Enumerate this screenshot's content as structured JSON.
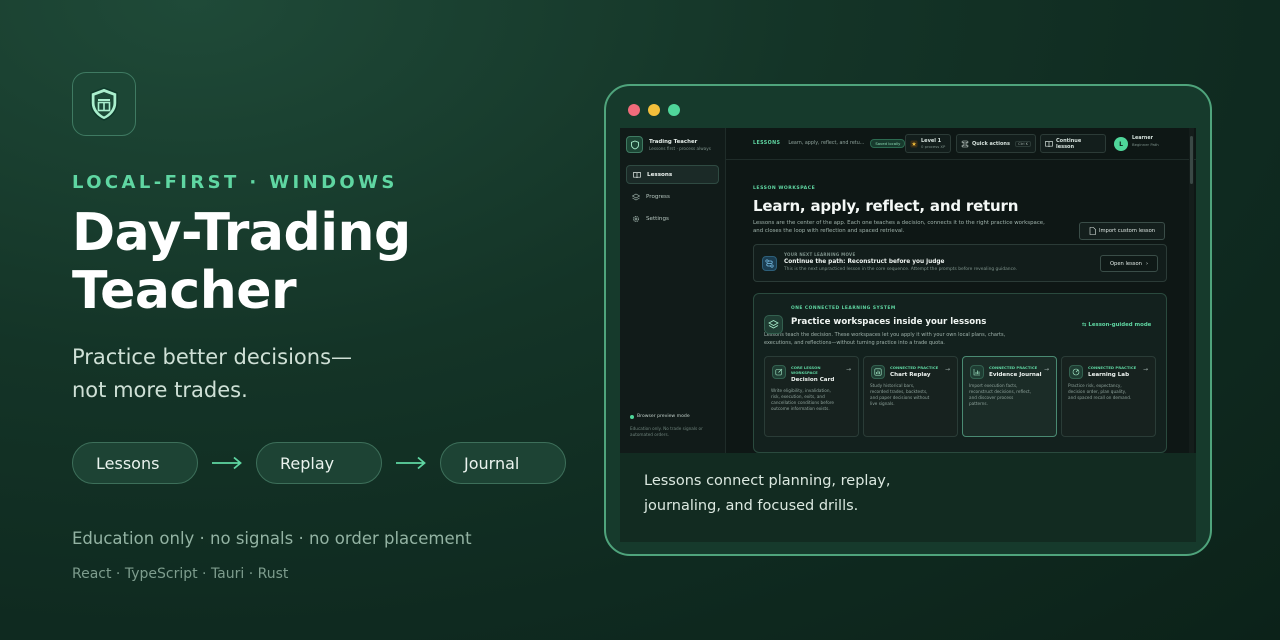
{
  "hero": {
    "eyebrow": "LOCAL-FIRST · WINDOWS",
    "title_line1": "Day-Trading",
    "title_line2": "Teacher",
    "subtitle_line1": "Practice better decisions—",
    "subtitle_line2": "not more trades.",
    "flow": [
      "Lessons",
      "Replay",
      "Journal"
    ],
    "note": "Education only · no signals · no order placement",
    "stack": "React · TypeScript · Tauri · Rust"
  },
  "preview": {
    "caption_line1": "Lessons connect planning, replay,",
    "caption_line2": "journaling, and focused drills."
  },
  "app": {
    "brand_title": "Trading Teacher",
    "brand_sub": "Lessons first · process always",
    "nav": [
      {
        "label": "Lessons",
        "icon": "book-icon",
        "active": true
      },
      {
        "label": "Progress",
        "icon": "layers-icon",
        "active": false
      },
      {
        "label": "Settings",
        "icon": "gear-icon",
        "active": false
      }
    ],
    "browse_title": "Browser preview mode",
    "browse_sub": "Education only. No trade signals or automated orders.",
    "topbar": {
      "section": "LESSONS",
      "section_sub": "Learn, apply, reflect, and retu...",
      "saved": "Saved locally",
      "level_title": "Level 1",
      "level_sub": "0 process XP",
      "quick_actions": "Quick actions",
      "quick_kbd": "Ctrl K",
      "continue": "Continue lesson",
      "avatar_initial": "L",
      "user_name": "Learner",
      "user_path": "Beginner Path"
    },
    "workspace": {
      "eyebrow": "LESSON WORKSPACE",
      "title": "Learn, apply, reflect, and return",
      "desc": "Lessons are the center of the app. Each one teaches a decision, connects it to the right practice workspace, and closes the loop with reflection and spaced retrieval.",
      "import_label": "Import custom lesson"
    },
    "next": {
      "eyebrow": "YOUR NEXT LEARNING MOVE",
      "title": "Continue the path: Reconstruct before you judge",
      "sub": "This is the next unpracticed lesson in the core sequence. Attempt the prompts before revealing guidance.",
      "button": "Open lesson"
    },
    "system": {
      "eyebrow": "ONE CONNECTED LEARNING SYSTEM",
      "title": "Practice workspaces inside your lessons",
      "guided": "Lesson-guided mode",
      "desc": "Lessons teach the decision. These workspaces let you apply it with your own local plans, charts, executions, and reflections—without turning practice into a trade quota.",
      "cards": [
        {
          "eyebrow": "CORE LESSON WORKSPACE",
          "title": "Decision Card",
          "desc": "Write eligibility, invalidation, risk, execution, exits, and cancellation conditions before outcome information exists."
        },
        {
          "eyebrow": "CONNECTED PRACTICE",
          "title": "Chart Replay",
          "desc": "Study historical bars, recorded trades, backtests, and paper decisions without live signals."
        },
        {
          "eyebrow": "CONNECTED PRACTICE",
          "title": "Evidence Journal",
          "desc": "Import execution facts, reconstruct decisions, reflect, and discover process patterns."
        },
        {
          "eyebrow": "CONNECTED PRACTICE",
          "title": "Learning Lab",
          "desc": "Practice risk, expectancy, decision order, plan quality, and spaced recall on demand."
        }
      ]
    }
  },
  "colors": {
    "accent": "#5fd6a2",
    "frame_border": "#4fa47c",
    "dot_red": "#f06b7b",
    "dot_yellow": "#f3bf3b",
    "dot_green": "#4fd69a"
  }
}
